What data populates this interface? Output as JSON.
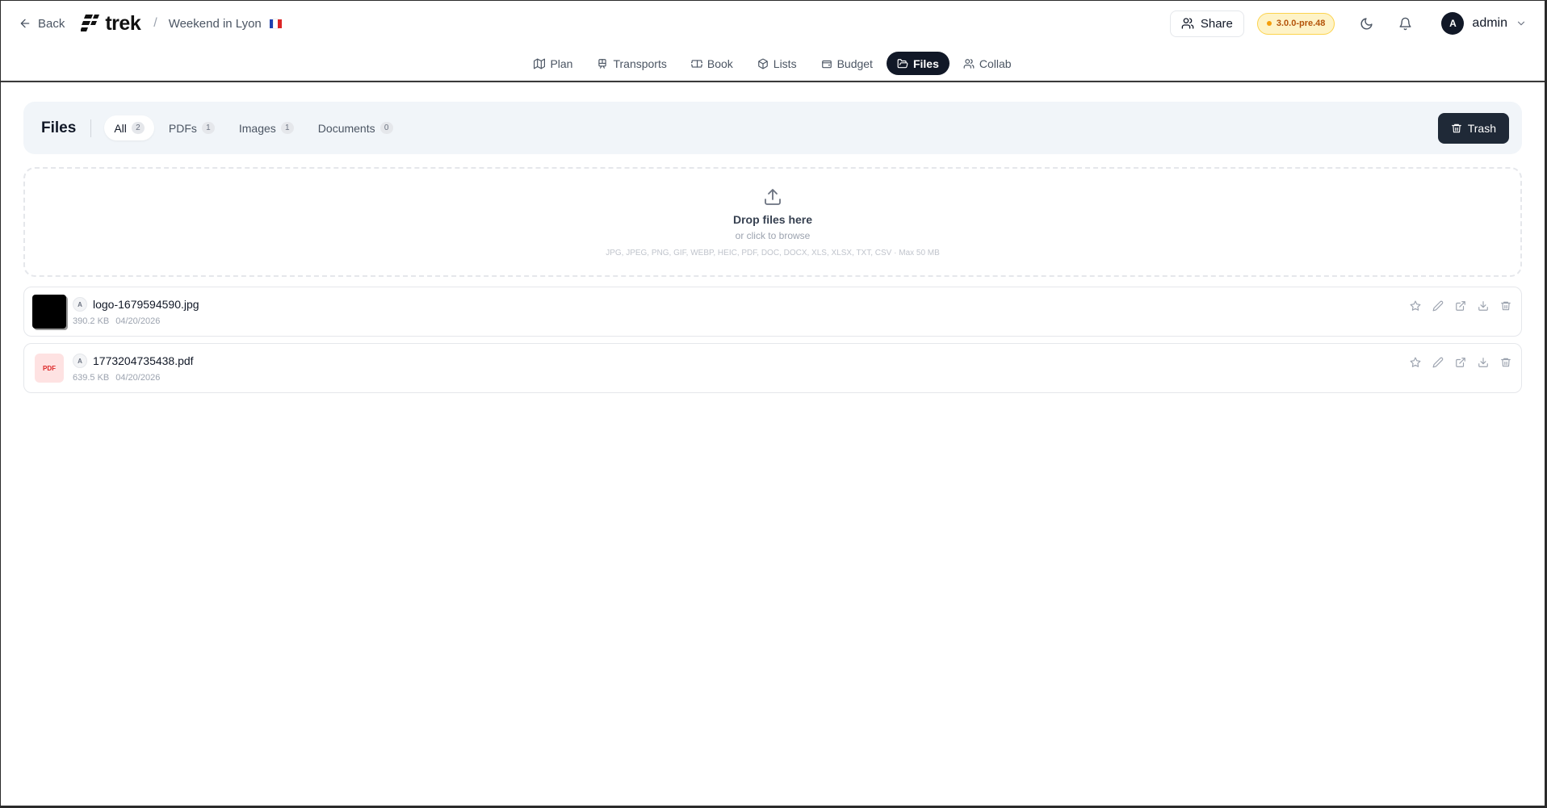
{
  "header": {
    "back_label": "Back",
    "logo_text": "trek",
    "trip_name": "Weekend in Lyon",
    "share_label": "Share",
    "version": "3.0.0-pre.48",
    "user_initial": "A",
    "username": "admin"
  },
  "nav": {
    "tabs": [
      {
        "label": "Plan",
        "icon": "map-icon"
      },
      {
        "label": "Transports",
        "icon": "train-icon"
      },
      {
        "label": "Book",
        "icon": "ticket-icon"
      },
      {
        "label": "Lists",
        "icon": "package-icon"
      },
      {
        "label": "Budget",
        "icon": "wallet-icon"
      },
      {
        "label": "Files",
        "icon": "folder-open-icon",
        "active": true
      },
      {
        "label": "Collab",
        "icon": "users-icon"
      }
    ]
  },
  "files": {
    "title": "Files",
    "filters": [
      {
        "label": "All",
        "count": "2",
        "active": true
      },
      {
        "label": "PDFs",
        "count": "1"
      },
      {
        "label": "Images",
        "count": "1"
      },
      {
        "label": "Documents",
        "count": "0"
      }
    ],
    "trash_label": "Trash"
  },
  "dropzone": {
    "title": "Drop files here",
    "subtitle": "or click to browse",
    "types": "JPG, JPEG, PNG, GIF, WEBP, HEIC, PDF, DOC, DOCX, XLS, XLSX, TXT, CSV · Max 50 MB"
  },
  "file_list": [
    {
      "name": "logo-1679594590.jpg",
      "size": "390.2 KB",
      "date": "04/20/2026",
      "uploader": "A",
      "type": "image"
    },
    {
      "name": "1773204735438.pdf",
      "size": "639.5 KB",
      "date": "04/20/2026",
      "uploader": "A",
      "type": "pdf",
      "thumb_label": "PDF"
    }
  ],
  "colors": {
    "accent_dark": "#111827",
    "version_badge_bg": "#fef3c7",
    "version_badge_text": "#b45309",
    "header_panel_bg": "#f1f5f9"
  }
}
